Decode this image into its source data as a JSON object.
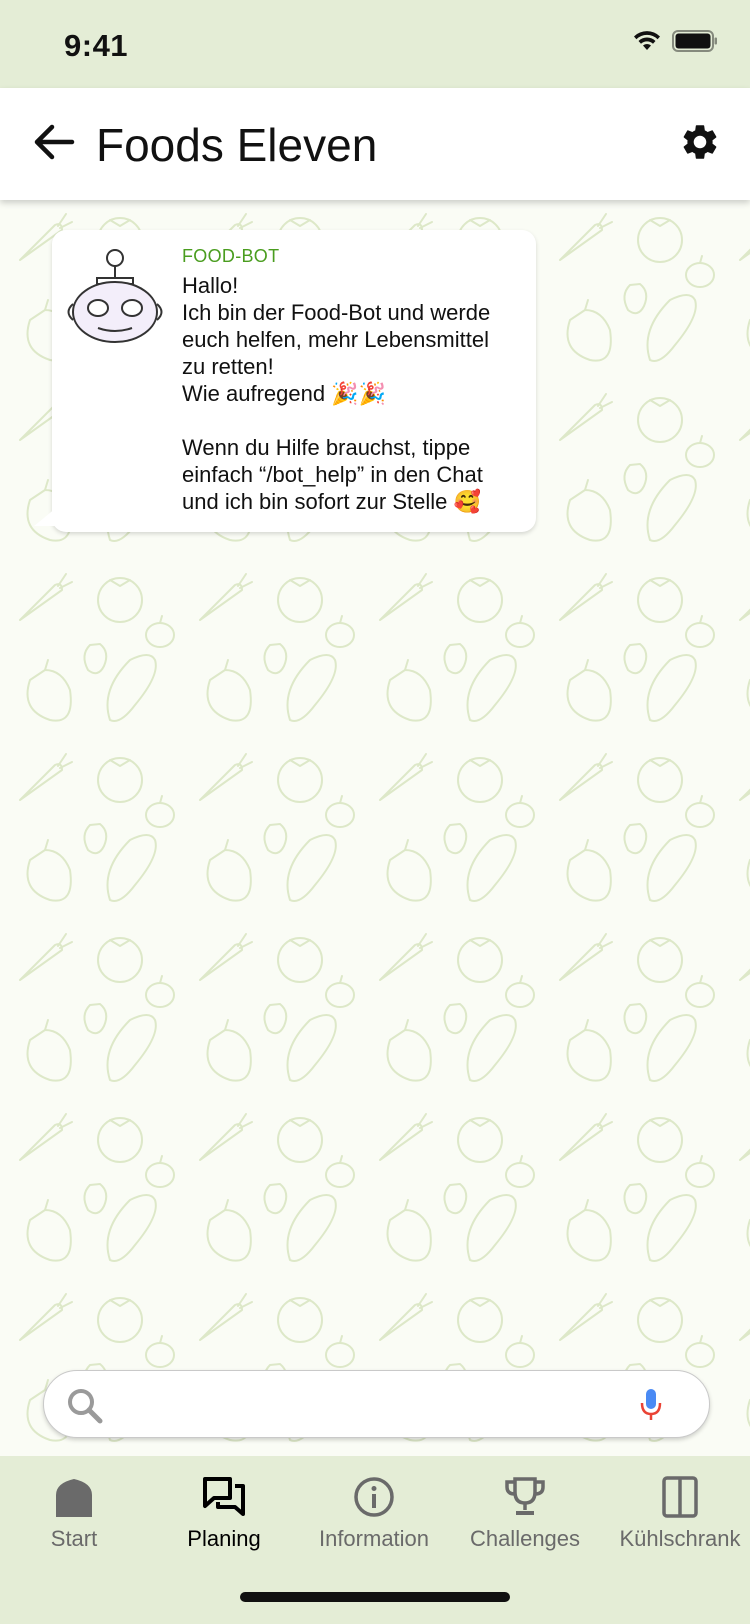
{
  "status_bar": {
    "time": "9:41"
  },
  "app_bar": {
    "title": "Foods Eleven"
  },
  "message": {
    "sender": "FOOD-BOT",
    "lines": [
      "Hallo!",
      "Ich bin der Food-Bot und werde",
      "euch helfen, mehr Lebensmittel",
      "zu retten!",
      "Wie aufregend 🎉🎉",
      "",
      "Wenn du Hilfe brauchst, tippe",
      "einfach “/bot_help”  in den Chat",
      "und ich bin sofort zur Stelle 🥰"
    ]
  },
  "search": {
    "value": "",
    "placeholder": ""
  },
  "nav": {
    "items": [
      {
        "label": "Start",
        "icon": "home-icon"
      },
      {
        "label": "Planing",
        "icon": "chat-icon"
      },
      {
        "label": "Information",
        "icon": "info-icon"
      },
      {
        "label": "Challenges",
        "icon": "trophy-icon"
      },
      {
        "label": "Kühlschrank",
        "icon": "fridge-icon"
      }
    ],
    "active_index": 1
  },
  "colors": {
    "accent_green": "#4a9d1f",
    "bar_background": "#e4edd6",
    "mic_blue": "#4a8af4",
    "mic_red": "#ea4335"
  }
}
